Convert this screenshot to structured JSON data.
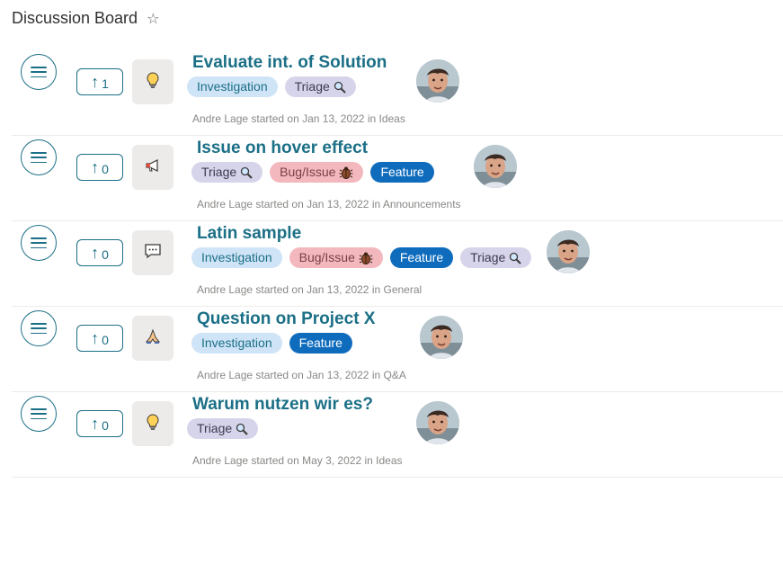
{
  "header": {
    "title": "Discussion Board",
    "star": "☆"
  },
  "posts": [
    {
      "title": "Evaluate int. of Solution",
      "votes": "1",
      "category_icon": "lightbulb-icon",
      "tags": [
        {
          "label": "Investigation",
          "kind": "investigation",
          "icon": ""
        },
        {
          "label": "Triage",
          "kind": "triage",
          "icon": "magnifier-icon"
        }
      ],
      "meta": "Andre Lage started on Jan 13, 2022 in Ideas"
    },
    {
      "title": "Issue on hover effect",
      "votes": "0",
      "category_icon": "megaphone-icon",
      "tags": [
        {
          "label": "Triage",
          "kind": "triage",
          "icon": "magnifier-icon"
        },
        {
          "label": "Bug/Issue",
          "kind": "bug",
          "icon": "bug-icon"
        },
        {
          "label": "Feature",
          "kind": "feature",
          "icon": ""
        }
      ],
      "meta": "Andre Lage started on Jan 13, 2022 in Announcements"
    },
    {
      "title": "Latin sample",
      "votes": "0",
      "category_icon": "chat-bubble-icon",
      "tags": [
        {
          "label": "Investigation",
          "kind": "investigation",
          "icon": ""
        },
        {
          "label": "Bug/Issue",
          "kind": "bug",
          "icon": "bug-icon"
        },
        {
          "label": "Feature",
          "kind": "feature",
          "icon": ""
        },
        {
          "label": "Triage",
          "kind": "triage",
          "icon": "magnifier-icon"
        }
      ],
      "meta": "Andre Lage started on Jan 13, 2022 in General"
    },
    {
      "title": "Question on Project X",
      "votes": "0",
      "category_icon": "praying-hands-icon",
      "tags": [
        {
          "label": "Investigation",
          "kind": "investigation",
          "icon": ""
        },
        {
          "label": "Feature",
          "kind": "feature",
          "icon": ""
        }
      ],
      "meta": "Andre Lage started on Jan 13, 2022 in Q&A"
    },
    {
      "title": "Warum nutzen wir es?",
      "votes": "0",
      "category_icon": "lightbulb-icon",
      "tags": [
        {
          "label": "Triage",
          "kind": "triage",
          "icon": "magnifier-icon"
        }
      ],
      "meta": "Andre Lage started on May 3, 2022 in Ideas"
    }
  ],
  "colors": {
    "accent": "#1b6f86",
    "feature": "#0f6cbd",
    "investigation": "#cfe4f7",
    "triage": "#d6d4ea",
    "bug": "#f3b8bd"
  }
}
